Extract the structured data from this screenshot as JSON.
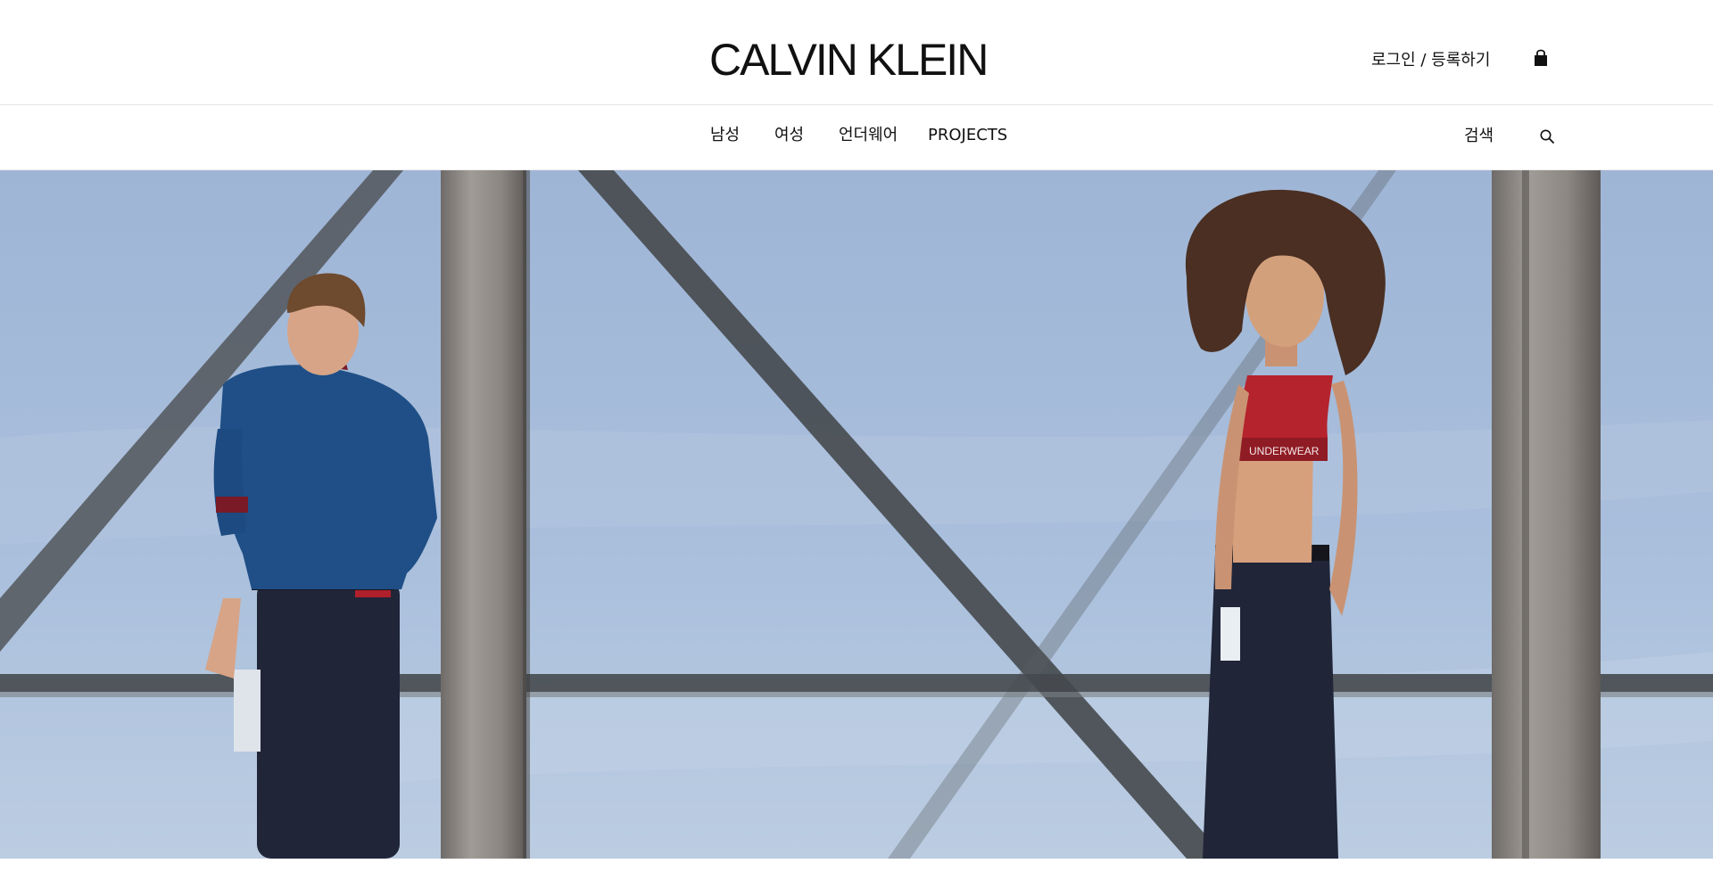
{
  "brand": {
    "logo_text": "CALVIN KLEIN"
  },
  "header": {
    "account_link": "로그인 / 등록하기",
    "cart_icon": "shopping-bag-icon"
  },
  "nav": {
    "items": [
      {
        "label": "남성"
      },
      {
        "label": "여성"
      },
      {
        "label": "언더웨어"
      },
      {
        "label": "PROJECTS"
      }
    ],
    "search_label": "검색",
    "search_icon": "search-icon"
  },
  "hero": {
    "bra_band_text": "UNDERWEAR",
    "colors": {
      "sky": "#a7bcd9",
      "steel": "#8a8784",
      "sweater": "#1f4f86",
      "bra": "#b5232d",
      "denim": "#202538"
    }
  }
}
